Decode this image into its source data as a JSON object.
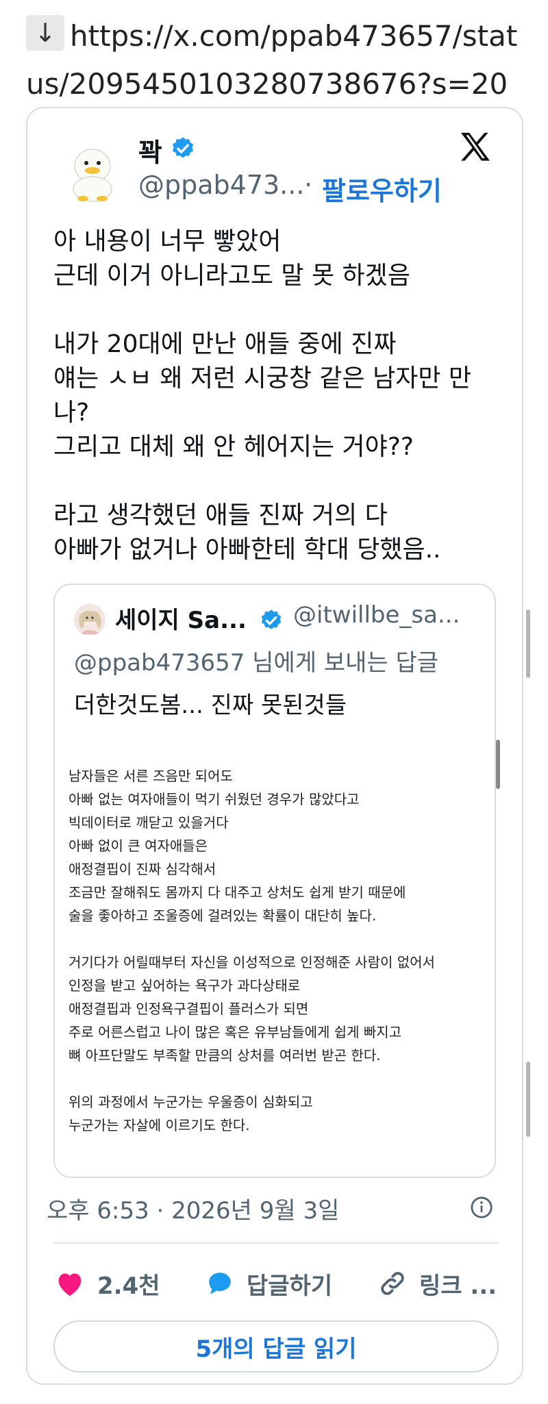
{
  "link": {
    "arrow": "↓",
    "url": "https://x.com/ppab473657/status/2095450103280738676?s=20"
  },
  "tweet": {
    "display_name": "꽉",
    "handle": "@ppab473...",
    "separator": "·",
    "follow_label": "팔로우하기",
    "lines": [
      "아 내용이 너무 빻았어",
      "근데 이거 아니라고도 말 못 하겠음",
      "",
      "내가 20대에 만난 애들 중에 진짜",
      "얘는 ㅅㅂ 왜 저런 시궁창 같은 남자만 만",
      "나?",
      "그리고 대체 왜 안 헤어지는 거야??",
      "",
      "라고 생각했던 애들 진짜 거의 다",
      "아빠가 없거나 아빠한테 학대 당했음.."
    ],
    "timestamp": "오후 6:53 · 2026년 9월 3일"
  },
  "quote": {
    "display_name": "세이지 Sa...",
    "handle": "@itwillbe_sa...",
    "reply_to": "@ppab473657 님에게 보내는 답글",
    "body": "더한것도봄... 진짜 못된것들",
    "image_lines": [
      "남자들은 서른 즈음만 되어도",
      "아빠 없는 여자애들이 먹기 쉬웠던 경우가 많았다고",
      "빅데이터로 깨닫고 있을거다",
      "아빠 없이 큰 여자애들은",
      "애정결핍이 진짜 심각해서",
      "조금만 잘해줘도 몸까지 다 대주고 상처도 쉽게 받기 때문에",
      "술을 좋아하고 조울증에 걸려있는 확률이 대단히 높다.",
      "",
      "거기다가 어릴때부터 자신을 이성적으로 인정해준 사람이 없어서",
      "인정을 받고 싶어하는 욕구가 과다상태로",
      "애정결핍과 인정욕구결핍이 플러스가 되면",
      "주로 어른스럽고 나이 많은 혹은 유부남들에게 쉽게 빠지고",
      "뼈 아프단말도 부족할 만큼의 상처를 여러번 받곤 한다.",
      "",
      "위의 과정에서 누군가는 우울증이 심화되고",
      "누군가는 자살에 이르기도 한다."
    ]
  },
  "actions": {
    "likes": "2.4천",
    "reply_label": "답글하기",
    "link_label": "링크 ..."
  },
  "read_replies_label": "5개의 답글 읽기",
  "colors": {
    "accent": "#1d75d8",
    "like": "#f91880",
    "verified": "#1d9bf0",
    "muted": "#536471",
    "border": "#d9dde1"
  },
  "icons": [
    "arrow-down-icon",
    "verified-icon",
    "x-logo-icon",
    "info-icon",
    "heart-icon",
    "reply-bubble-icon",
    "link-icon"
  ]
}
